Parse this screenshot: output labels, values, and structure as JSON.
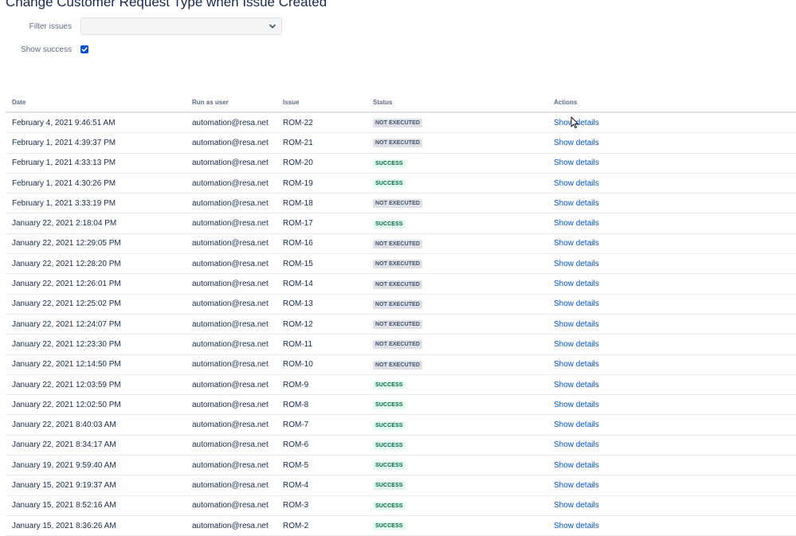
{
  "page": {
    "title": "Change Customer Request Type when Issue Created"
  },
  "filter": {
    "label": "Filter issues",
    "value": "",
    "icon": "chevron-down-icon"
  },
  "show_success": {
    "label": "Show success",
    "checked": true,
    "icon": "checkmark-icon"
  },
  "colors": {
    "link": "#0052cc",
    "checkbox": "#0052cc",
    "success_bg": "#e3fcef",
    "success_text": "#006644",
    "default_bg": "#dfe1e6",
    "default_text": "#42526e"
  },
  "table": {
    "columns": [
      "Date",
      "Run as user",
      "Issue",
      "Status",
      "Actions"
    ],
    "rows": [
      {
        "date": "February 4, 2021 9:46:51 AM",
        "user": "automation@resa.net",
        "issue": "ROM-22",
        "status": "NOT EXECUTED",
        "status_type": "default",
        "action": "Show details"
      },
      {
        "date": "February 1, 2021 4:39:37 PM",
        "user": "automation@resa.net",
        "issue": "ROM-21",
        "status": "NOT EXECUTED",
        "status_type": "default",
        "action": "Show details"
      },
      {
        "date": "February 1, 2021 4:33:13 PM",
        "user": "automation@resa.net",
        "issue": "ROM-20",
        "status": "SUCCESS",
        "status_type": "success",
        "action": "Show details"
      },
      {
        "date": "February 1, 2021 4:30:26 PM",
        "user": "automation@resa.net",
        "issue": "ROM-19",
        "status": "SUCCESS",
        "status_type": "success",
        "action": "Show details"
      },
      {
        "date": "February 1, 2021 3:33:19 PM",
        "user": "automation@resa.net",
        "issue": "ROM-18",
        "status": "NOT EXECUTED",
        "status_type": "default",
        "action": "Show details"
      },
      {
        "date": "January 22, 2021 2:18:04 PM",
        "user": "automation@resa.net",
        "issue": "ROM-17",
        "status": "SUCCESS",
        "status_type": "success",
        "action": "Show details"
      },
      {
        "date": "January 22, 2021 12:29:05 PM",
        "user": "automation@resa.net",
        "issue": "ROM-16",
        "status": "NOT EXECUTED",
        "status_type": "default",
        "action": "Show details"
      },
      {
        "date": "January 22, 2021 12:28:20 PM",
        "user": "automation@resa.net",
        "issue": "ROM-15",
        "status": "NOT EXECUTED",
        "status_type": "default",
        "action": "Show details"
      },
      {
        "date": "January 22, 2021 12:26:01 PM",
        "user": "automation@resa.net",
        "issue": "ROM-14",
        "status": "NOT EXECUTED",
        "status_type": "default",
        "action": "Show details"
      },
      {
        "date": "January 22, 2021 12:25:02 PM",
        "user": "automation@resa.net",
        "issue": "ROM-13",
        "status": "NOT EXECUTED",
        "status_type": "default",
        "action": "Show details"
      },
      {
        "date": "January 22, 2021 12:24:07 PM",
        "user": "automation@resa.net",
        "issue": "ROM-12",
        "status": "NOT EXECUTED",
        "status_type": "default",
        "action": "Show details"
      },
      {
        "date": "January 22, 2021 12:23:30 PM",
        "user": "automation@resa.net",
        "issue": "ROM-11",
        "status": "NOT EXECUTED",
        "status_type": "default",
        "action": "Show details"
      },
      {
        "date": "January 22, 2021 12:14:50 PM",
        "user": "automation@resa.net",
        "issue": "ROM-10",
        "status": "NOT EXECUTED",
        "status_type": "default",
        "action": "Show details"
      },
      {
        "date": "January 22, 2021 12:03:59 PM",
        "user": "automation@resa.net",
        "issue": "ROM-9",
        "status": "SUCCESS",
        "status_type": "success",
        "action": "Show details"
      },
      {
        "date": "January 22, 2021 12:02:50 PM",
        "user": "automation@resa.net",
        "issue": "ROM-8",
        "status": "SUCCESS",
        "status_type": "success",
        "action": "Show details"
      },
      {
        "date": "January 22, 2021 8:40:03 AM",
        "user": "automation@resa.net",
        "issue": "ROM-7",
        "status": "SUCCESS",
        "status_type": "success",
        "action": "Show details"
      },
      {
        "date": "January 22, 2021 8:34:17 AM",
        "user": "automation@resa.net",
        "issue": "ROM-6",
        "status": "SUCCESS",
        "status_type": "success",
        "action": "Show details"
      },
      {
        "date": "January 19, 2021 9:59:40 AM",
        "user": "automation@resa.net",
        "issue": "ROM-5",
        "status": "SUCCESS",
        "status_type": "success",
        "action": "Show details"
      },
      {
        "date": "January 15, 2021 9:19:37 AM",
        "user": "automation@resa.net",
        "issue": "ROM-4",
        "status": "SUCCESS",
        "status_type": "success",
        "action": "Show details"
      },
      {
        "date": "January 15, 2021 8:52:16 AM",
        "user": "automation@resa.net",
        "issue": "ROM-3",
        "status": "SUCCESS",
        "status_type": "success",
        "action": "Show details"
      },
      {
        "date": "January 15, 2021 8:36:26 AM",
        "user": "automation@resa.net",
        "issue": "ROM-2",
        "status": "SUCCESS",
        "status_type": "success",
        "action": "Show details"
      }
    ]
  }
}
